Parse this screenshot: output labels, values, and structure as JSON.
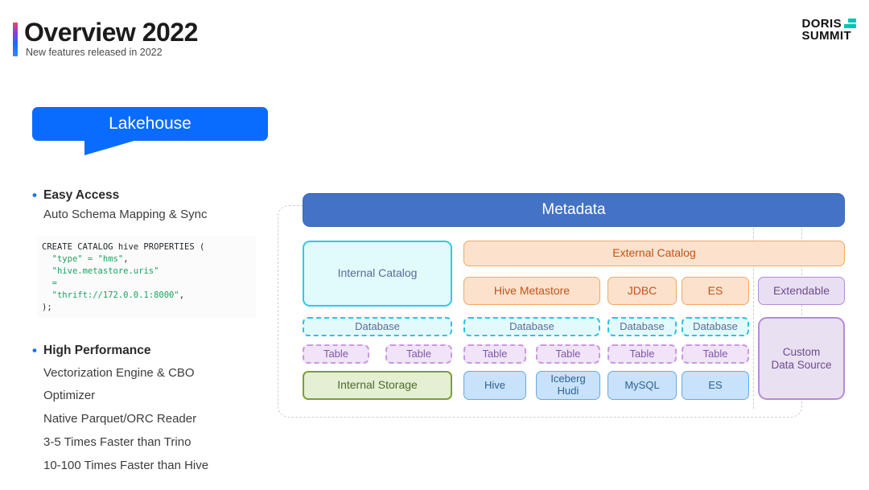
{
  "header": {
    "title": "Overview 2022",
    "subtitle": "New features released in 2022",
    "logo_line1": "DORIS",
    "logo_line2": "SUMMIT",
    "accent_color": "#0a6cff"
  },
  "banner": {
    "label": "Lakehouse",
    "color": "#0a6cff"
  },
  "features": [
    {
      "heading": "Easy Access",
      "lines": [
        "Auto Schema Mapping & Sync"
      ]
    },
    {
      "heading": "High Performance",
      "lines": [
        "Vectorization Engine & CBO",
        "Optimizer",
        "Native Parquet/ORC Reader",
        "3-5 Times Faster than Trino",
        "10-100 Times Faster than Hive"
      ]
    }
  ],
  "code": {
    "line1_plain": "CREATE CATALOG hive PROPERTIES (",
    "line2_key": "\"type\"",
    "line2_op": "=",
    "line2_val": "\"hms\"",
    "line2_tail": ",",
    "line3_key": "\"hive.metastore.uris\"",
    "line4_op": "=",
    "line5_val": "\"thrift://172.0.0.1:8000\"",
    "line5_tail": ",",
    "line6_plain": ");"
  },
  "diagram": {
    "metadata": "Metadata",
    "internal_catalog": "Internal Catalog",
    "external_catalog": "External Catalog",
    "external_sources": [
      "Hive Metastore",
      "JDBC",
      "ES"
    ],
    "extendable": "Extendable",
    "databases": [
      "Database",
      "Database",
      "Database",
      "Database"
    ],
    "tables": [
      "Table",
      "Table",
      "Table",
      "Table",
      "Table",
      "Table"
    ],
    "internal_storage": "Internal Storage",
    "stores": [
      "Hive",
      "Iceberg\nHudi",
      "MySQL",
      "ES"
    ],
    "custom_data_source": "Custom\nData Source"
  }
}
